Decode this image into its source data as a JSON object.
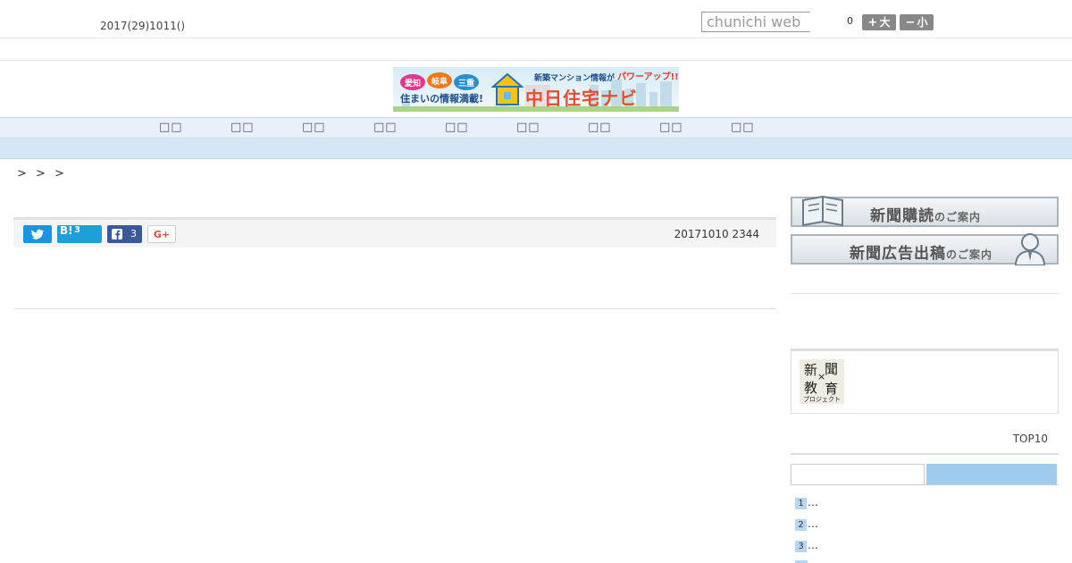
{
  "header": {
    "date": "2017(29)1011()",
    "search_placeholder": "chunichi web",
    "counter": "0",
    "font_bigger_label": "大",
    "font_smaller_label": "小"
  },
  "banner": {
    "headline_right": "新築マンション情報が",
    "headline_power": "パワーアップ!!",
    "tags": [
      "愛知",
      "岐阜",
      "三重"
    ],
    "tagline": "住まいの情報満載!",
    "brand": "中日住宅ナビ"
  },
  "nav": {
    "items": [
      "",
      "",
      "",
      "",
      "",
      "",
      "",
      "",
      ""
    ]
  },
  "breadcrumb": {
    "text": "> > >"
  },
  "article": {
    "share": {
      "hatena_label": "B!",
      "hatena_count": "3",
      "facebook_count": "3",
      "gplus_label": "G+"
    },
    "datetime": "20171010 2344"
  },
  "sidebar": {
    "subscribe_main": "新聞購読",
    "subscribe_suffix": "のご案内",
    "advertise_main": "新聞広告出稿",
    "advertise_suffix": "のご案内",
    "edu_logo": {
      "top_left": "新",
      "top_right": "聞",
      "cross": "×",
      "bottom_left": "教",
      "bottom_right": "育",
      "caption": "プロジェクト"
    },
    "ranking_title": "TOP10",
    "ranking_items": [
      {
        "rank": "1",
        "text": "…"
      },
      {
        "rank": "2",
        "text": "…"
      },
      {
        "rank": "3",
        "text": "…"
      }
    ]
  },
  "colors": {
    "nav_bg": "#e8f1fa",
    "subnav_bg": "#d7e6f3",
    "tab_active": "#9ecbee",
    "twitter": "#1b95e0",
    "hatena": "#1d9fd8",
    "facebook": "#3b5998"
  }
}
